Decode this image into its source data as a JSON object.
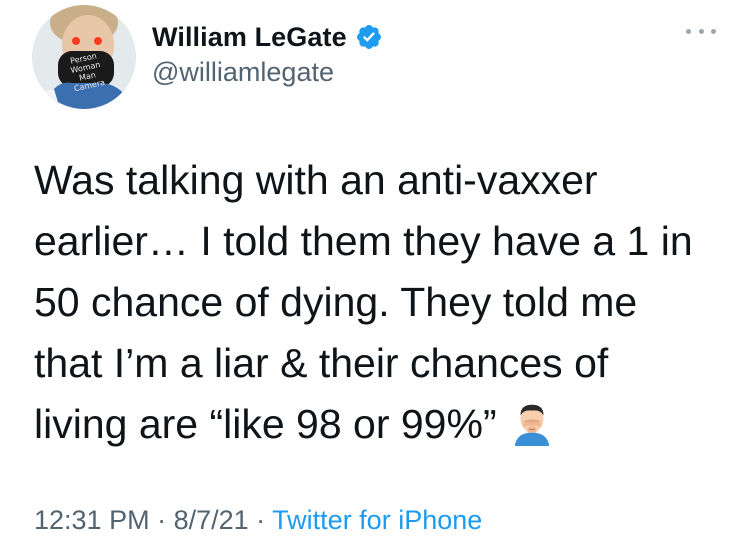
{
  "author": {
    "display_name": "William LeGate",
    "handle": "@williamlegate",
    "verified": true,
    "avatar_mask_text": [
      "Person",
      "Woman",
      "Man",
      "Camera"
    ]
  },
  "tweet": {
    "lines": [
      "Was talking with an anti-vaxxer",
      "earlier… I told them they have a 1 in",
      "50 chance of dying. They told me",
      "that I’m a liar & their chances of",
      "living are “like 98 or 99%”"
    ],
    "trailing_emoji": "man-facepalming-icon"
  },
  "meta": {
    "time": "12:31 PM",
    "sep1": " · ",
    "date": "8/7/21",
    "sep2": " · ",
    "source": "Twitter for iPhone"
  },
  "colors": {
    "text": "#0f1419",
    "secondary": "#536471",
    "accent": "#1d9bf0"
  }
}
